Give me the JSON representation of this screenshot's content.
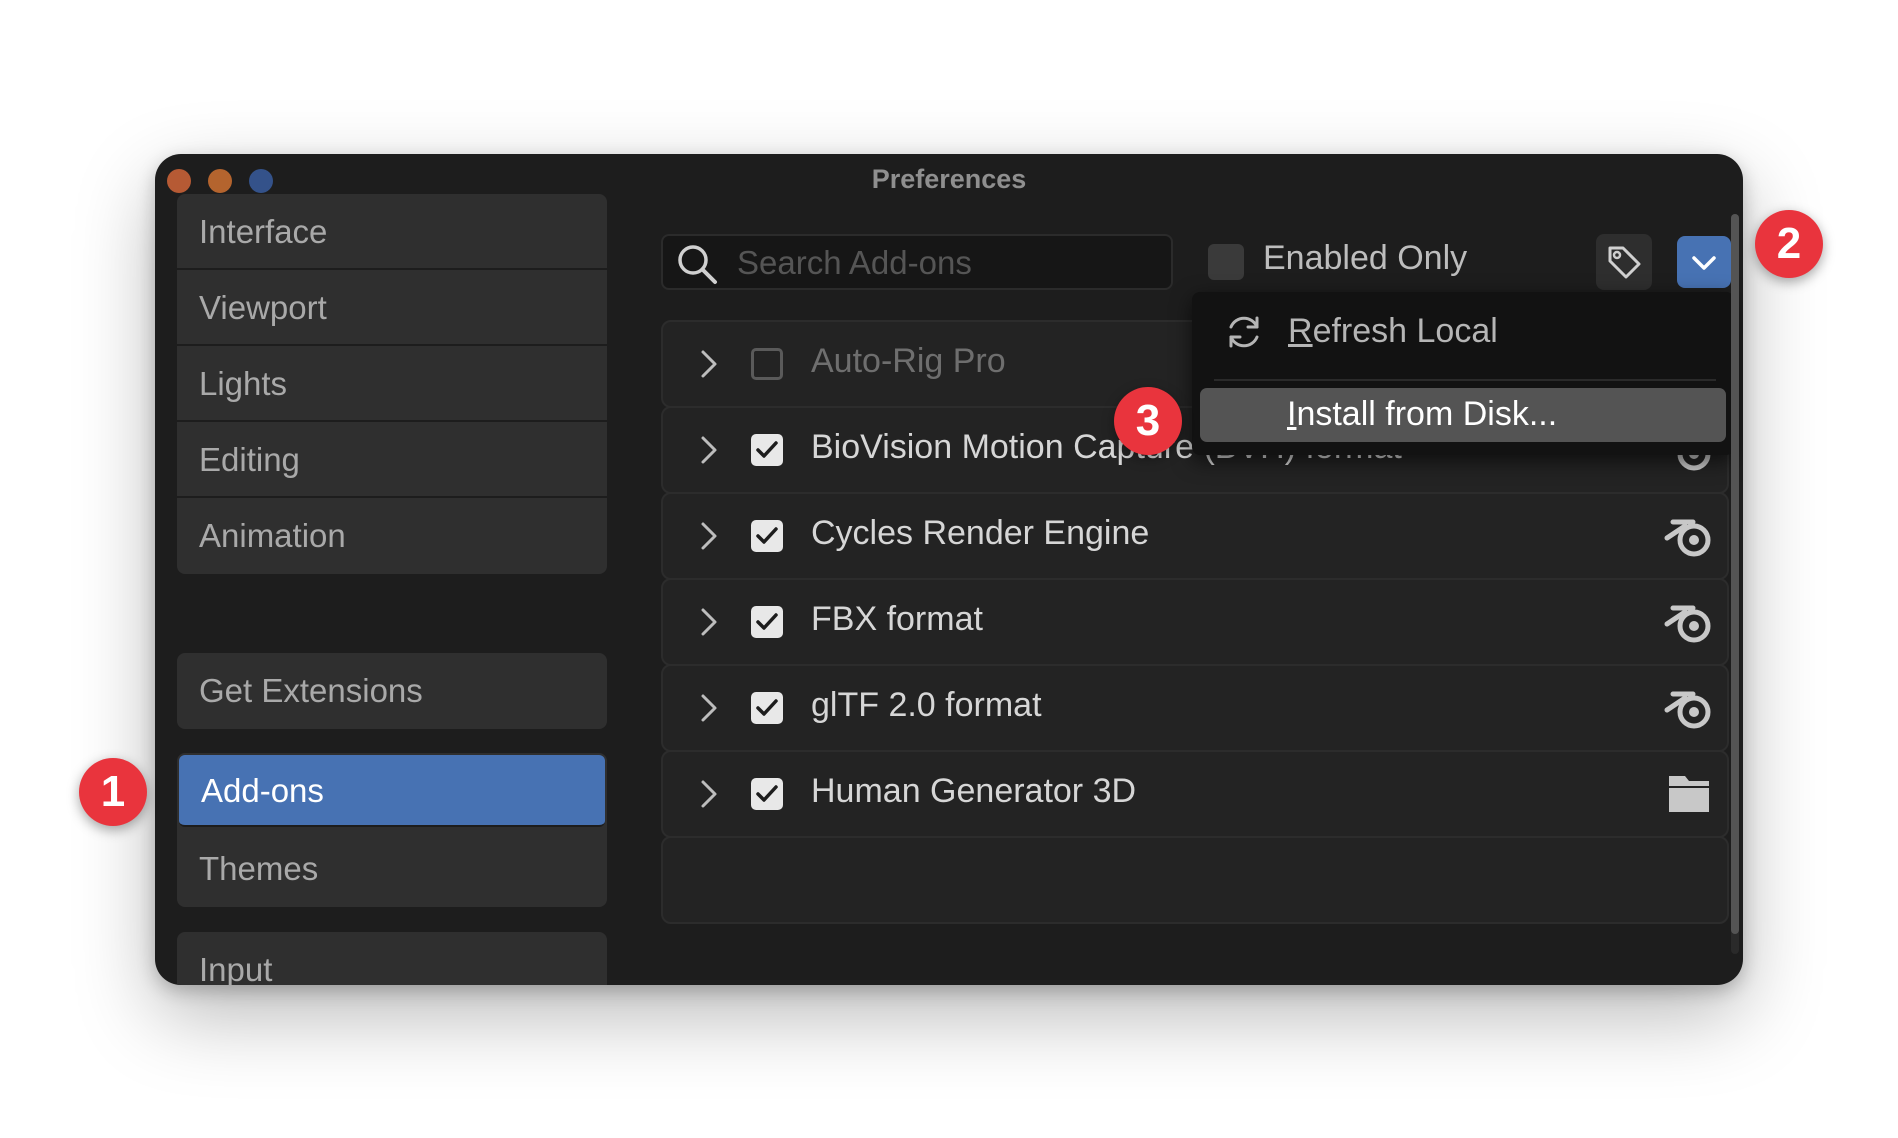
{
  "window": {
    "title": "Preferences"
  },
  "sidebar": {
    "groups": [
      {
        "items": [
          {
            "label": "Interface",
            "active": false
          },
          {
            "label": "Viewport",
            "active": false
          },
          {
            "label": "Lights",
            "active": false
          },
          {
            "label": "Editing",
            "active": false
          },
          {
            "label": "Animation",
            "active": false
          }
        ]
      },
      {
        "items": [
          {
            "label": "Get Extensions",
            "active": false
          }
        ]
      },
      {
        "items": [
          {
            "label": "Add-ons",
            "active": true
          },
          {
            "label": "Themes",
            "active": false
          }
        ]
      },
      {
        "items": [
          {
            "label": "Input",
            "active": false
          }
        ]
      }
    ]
  },
  "toolbar": {
    "search_placeholder": "Search Add-ons",
    "search_value": "",
    "enabled_only_label": "Enabled Only",
    "enabled_only_checked": false,
    "tag_icon": "tag-icon",
    "dropdown_icon": "chevron-down-icon"
  },
  "addons": [
    {
      "name": "Auto-Rig Pro",
      "enabled": false,
      "source_icon": "none"
    },
    {
      "name": "BioVision Motion Capture (BVH) format",
      "enabled": true,
      "source_icon": "blender-logo-icon"
    },
    {
      "name": "Cycles Render Engine",
      "enabled": true,
      "source_icon": "blender-logo-icon"
    },
    {
      "name": "FBX format",
      "enabled": true,
      "source_icon": "blender-logo-icon"
    },
    {
      "name": "glTF 2.0 format",
      "enabled": true,
      "source_icon": "blender-logo-icon"
    },
    {
      "name": "Human Generator 3D",
      "enabled": true,
      "source_icon": "folder-icon"
    }
  ],
  "dropdown_menu": {
    "items": [
      {
        "label": "Refresh Local",
        "icon": "refresh-icon",
        "highlighted": false
      },
      {
        "label": "Install from Disk...",
        "icon": "none",
        "highlighted": true
      }
    ]
  },
  "markers": [
    "1",
    "2",
    "3"
  ],
  "colors": {
    "accent": "#4772b3",
    "marker": "#e9343d",
    "window_bg": "#1d1d1d"
  }
}
